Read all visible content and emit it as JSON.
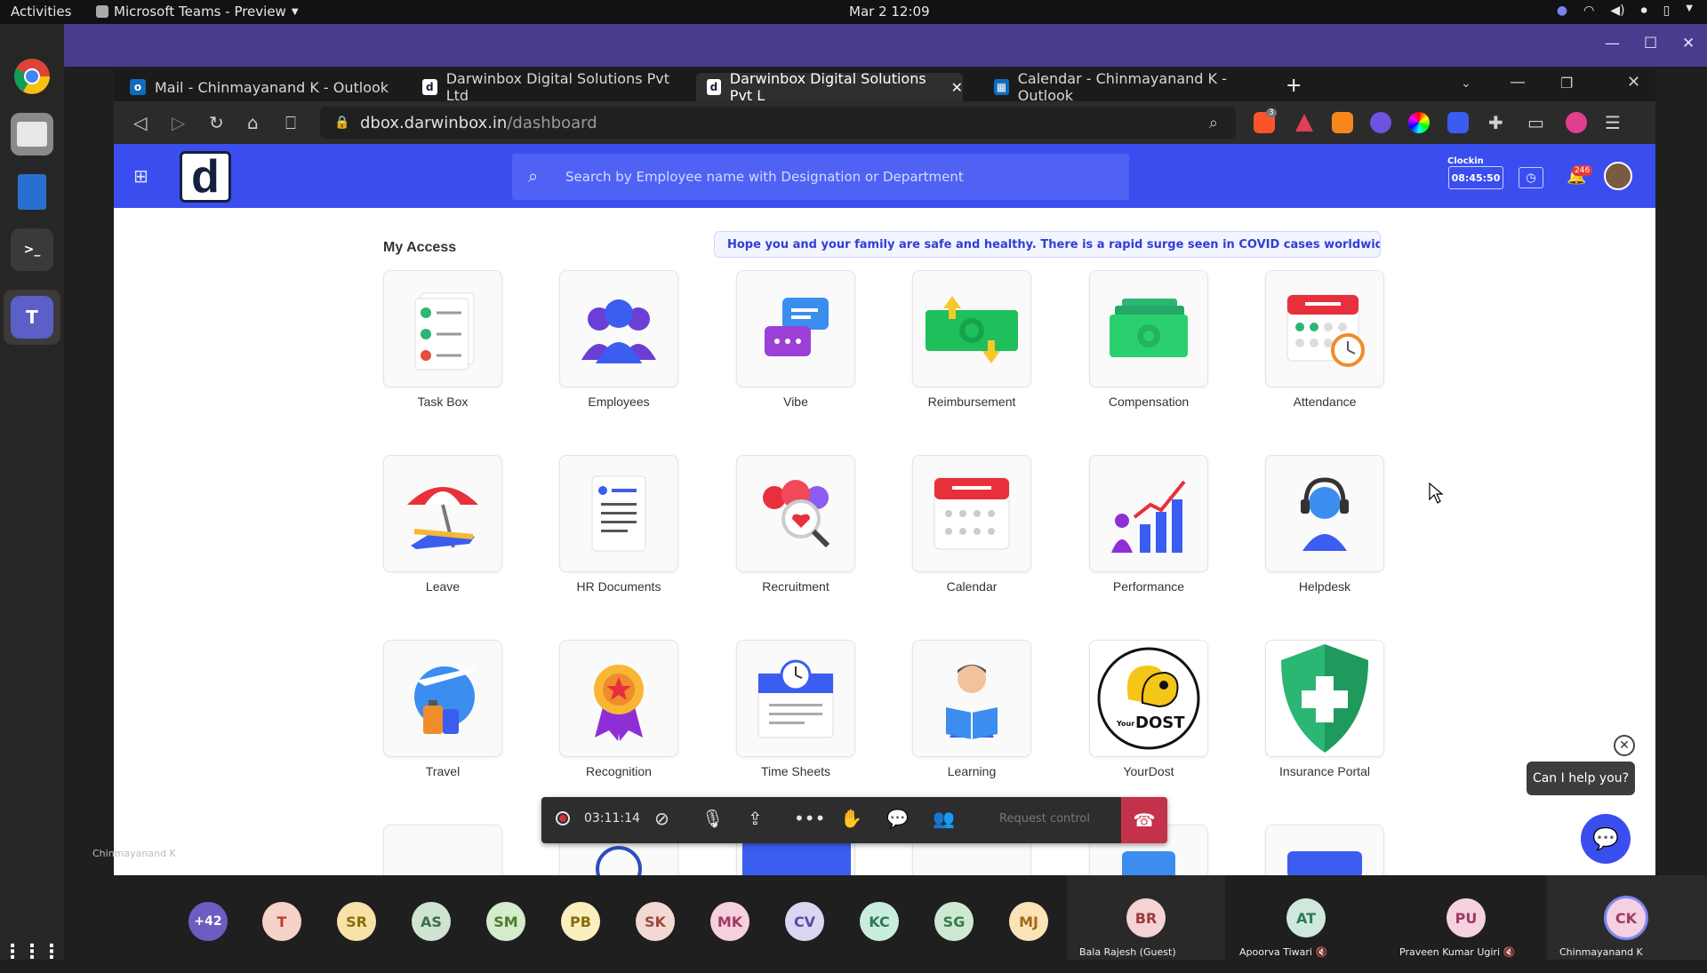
{
  "topbar": {
    "activities": "Activities",
    "app_menu": "Microsoft Teams - Preview",
    "clock": "Mar 2  12:09"
  },
  "browser": {
    "tabs": [
      {
        "title": "Mail - Chinmayanand K - Outlook",
        "active": false
      },
      {
        "title": "Darwinbox Digital Solutions Pvt Ltd",
        "active": false
      },
      {
        "title": "Darwinbox Digital Solutions Pvt L",
        "active": true
      },
      {
        "title": "Calendar - Chinmayanand K - Outlook",
        "active": false
      }
    ],
    "url_host": "dbox.darwinbox.in",
    "url_path": "/dashboard",
    "brave_badge": "3"
  },
  "app": {
    "logo_letter": "d",
    "search_placeholder": "Search by Employee name with Designation or Department",
    "clockin_label": "Clockin",
    "clockin_time": "08:45:50",
    "notification_count": "246",
    "section_title": "My Access",
    "banner": "Hope you and your family are safe and healthy. There is a rapid surge seen in COVID cases worldwide. Kindly reach out t",
    "tiles": [
      {
        "label": "Task Box"
      },
      {
        "label": "Employees"
      },
      {
        "label": "Vibe"
      },
      {
        "label": "Reimbursement"
      },
      {
        "label": "Compensation"
      },
      {
        "label": "Attendance"
      },
      {
        "label": "Leave"
      },
      {
        "label": "HR Documents"
      },
      {
        "label": "Recruitment"
      },
      {
        "label": "Calendar"
      },
      {
        "label": "Performance"
      },
      {
        "label": "Helpdesk"
      },
      {
        "label": "Travel"
      },
      {
        "label": "Recognition"
      },
      {
        "label": "Time Sheets"
      },
      {
        "label": "Learning"
      },
      {
        "label": "YourDost"
      },
      {
        "label": "Insurance Portal"
      }
    ],
    "yourdost_text": "DOST",
    "yourdost_small": "Your"
  },
  "call": {
    "timer": "03:11:14",
    "request_control": "Request control",
    "sharer_name": "Chinmayanand K"
  },
  "chat": {
    "bubble": "Can I help you?"
  },
  "participants": {
    "overflow": "+42",
    "small": [
      {
        "initials": "T",
        "bg": "#f6d2c9",
        "fg": "#c0392b"
      },
      {
        "initials": "SR",
        "bg": "#f9e2a8",
        "fg": "#8a6d0b"
      },
      {
        "initials": "AS",
        "bg": "#cfe3d2",
        "fg": "#3c6e47"
      },
      {
        "initials": "SM",
        "bg": "#d4ecc9",
        "fg": "#4d7a33"
      },
      {
        "initials": "PB",
        "bg": "#fbeebf",
        "fg": "#8a6d0b"
      },
      {
        "initials": "SK",
        "bg": "#f2d9d3",
        "fg": "#9c4a3c"
      },
      {
        "initials": "MK",
        "bg": "#f5d0de",
        "fg": "#a03a62"
      },
      {
        "initials": "CV",
        "bg": "#dcd6f3",
        "fg": "#5a4aa6"
      },
      {
        "initials": "KC",
        "bg": "#c9eddc",
        "fg": "#2e7a55"
      },
      {
        "initials": "SG",
        "bg": "#cde9d3",
        "fg": "#3a7a4a"
      },
      {
        "initials": "MJ",
        "bg": "#fbe3b8",
        "fg": "#a46a12"
      }
    ],
    "large": [
      {
        "initials": "BR",
        "name": "Bala Rajesh (Guest)",
        "bg": "#f3d3d3",
        "fg": "#9c3b3b",
        "muted": false
      },
      {
        "initials": "AT",
        "name": "Apoorva Tiwari",
        "bg": "#cfe8dc",
        "fg": "#2e7a55",
        "muted": true
      },
      {
        "initials": "PU",
        "name": "Praveen Kumar Ugiri",
        "bg": "#f4d2e0",
        "fg": "#a03a62",
        "muted": true
      },
      {
        "initials": "CK",
        "name": "Chinmayanand K",
        "bg": "#f5d0de",
        "fg": "#a03a62",
        "muted": false
      }
    ]
  },
  "colors": {
    "brand": "#3a4ef0",
    "teams_header": "#4b3b8f",
    "hangup": "#c4314b"
  }
}
